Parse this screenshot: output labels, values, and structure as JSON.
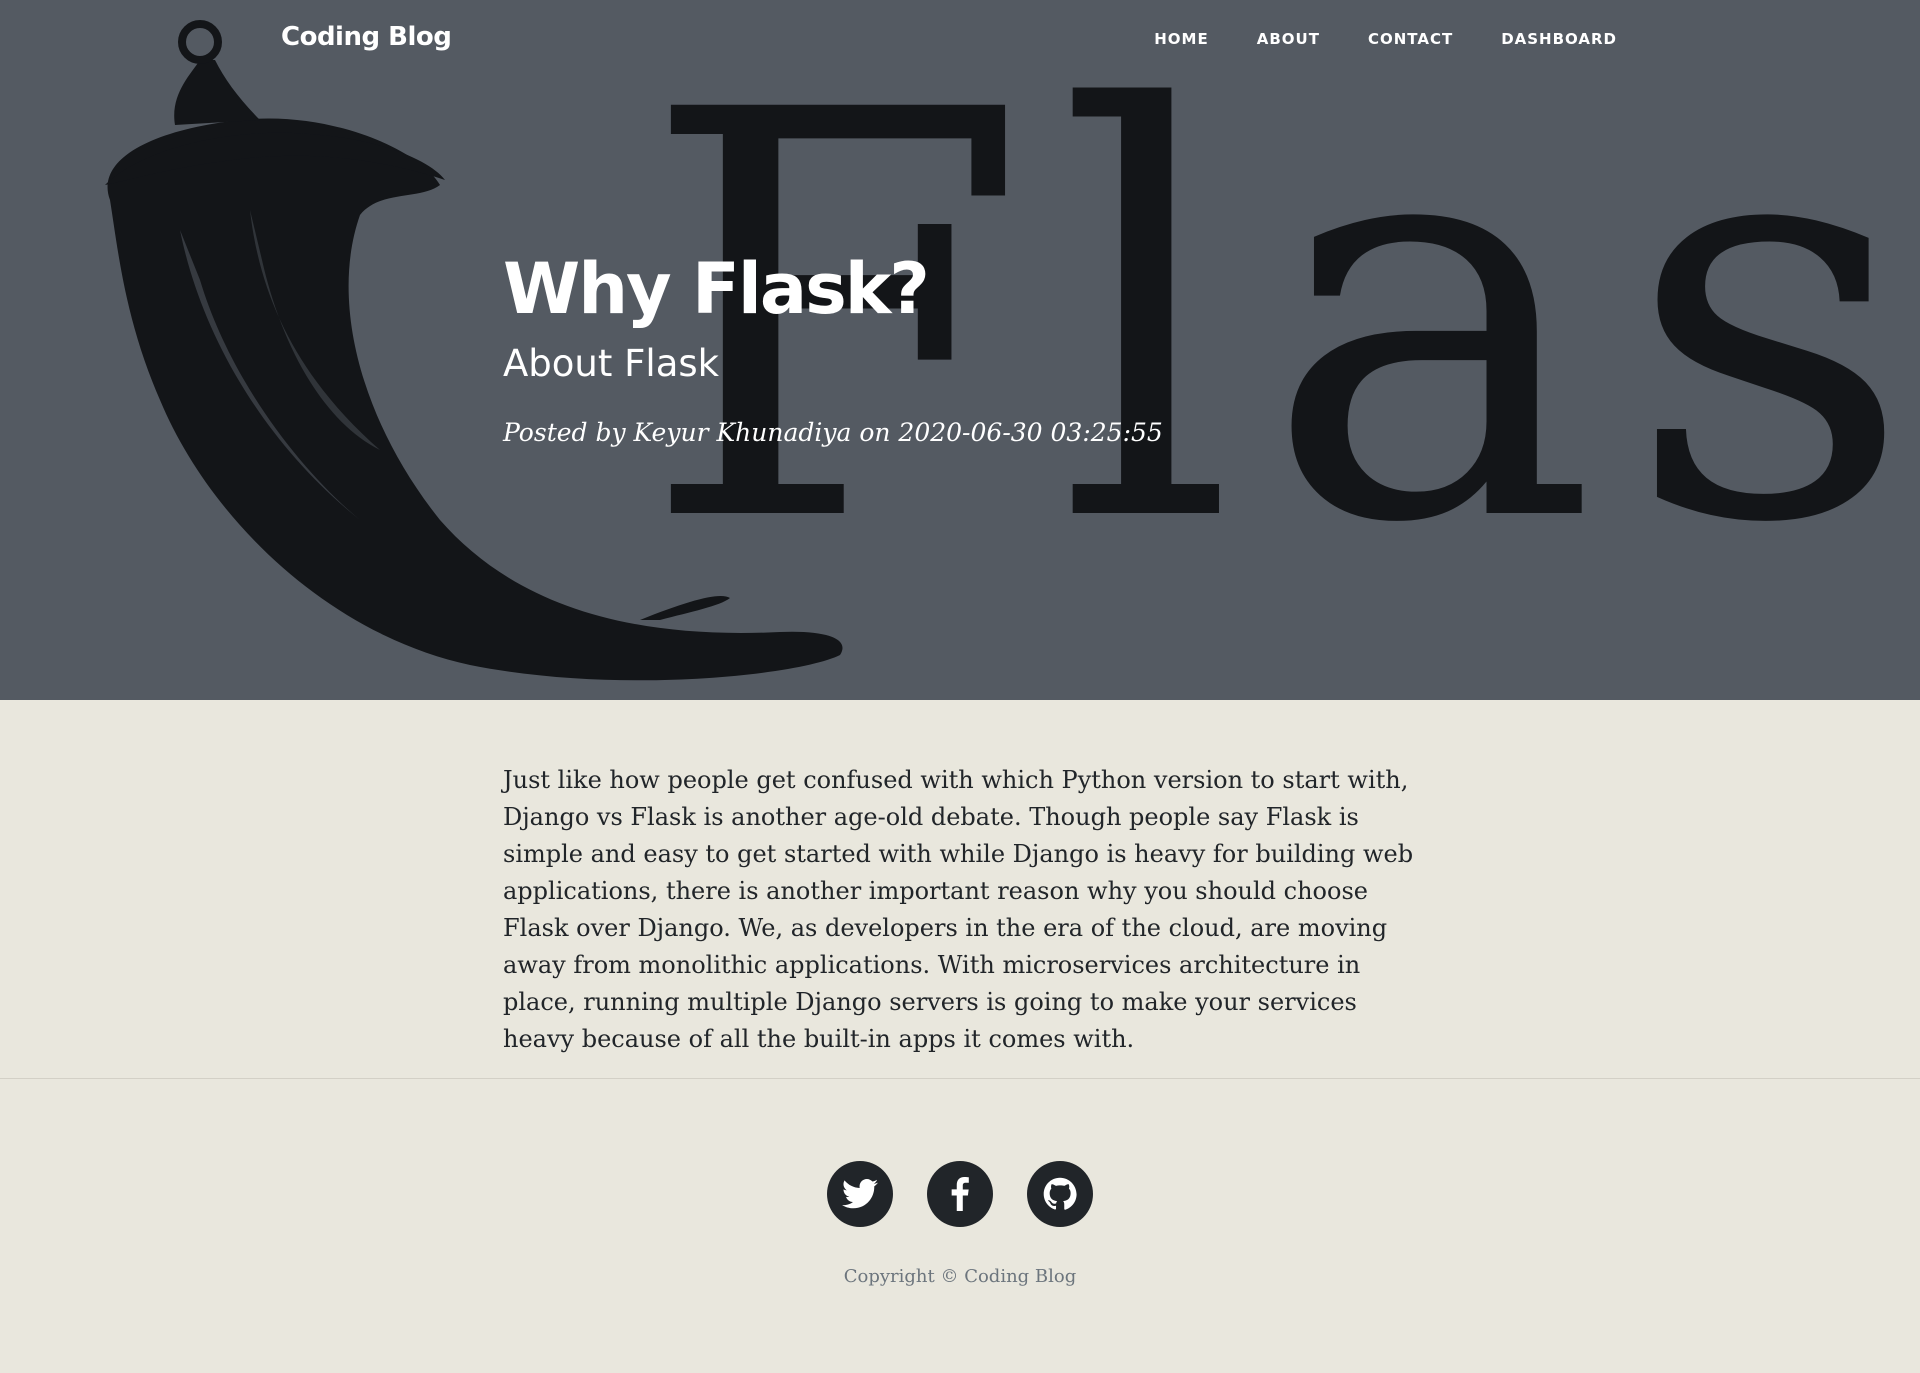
{
  "nav": {
    "brand": "Coding Blog",
    "links": [
      {
        "label": "HOME"
      },
      {
        "label": "ABOUT"
      },
      {
        "label": "CONTACT"
      },
      {
        "label": "DASHBOARD"
      }
    ]
  },
  "hero": {
    "background_word": "Flask",
    "title": "Why Flask?",
    "subtitle": "About Flask",
    "meta": "Posted by Keyur Khunadiya on 2020-06-30 03:25:55"
  },
  "post": {
    "body": "Just like how people get confused with which Python version to start with, Django vs Flask is another age-old debate. Though people say Flask is simple and easy to get started with while Django is heavy for building web applications, there is another important reason why you should choose Flask over Django. We, as developers in the era of the cloud, are moving away from monolithic applications. With microservices architecture in place, running multiple Django servers is going to make your services heavy because of all the built-in apps it comes with."
  },
  "footer": {
    "social": [
      {
        "icon": "twitter-icon"
      },
      {
        "icon": "facebook-icon"
      },
      {
        "icon": "github-icon"
      }
    ],
    "copyright": "Copyright © Coding Blog"
  },
  "colors": {
    "hero_bg": "#545a62",
    "page_bg": "#e9e7dd",
    "dark": "#212529",
    "muted": "#6c757d"
  }
}
